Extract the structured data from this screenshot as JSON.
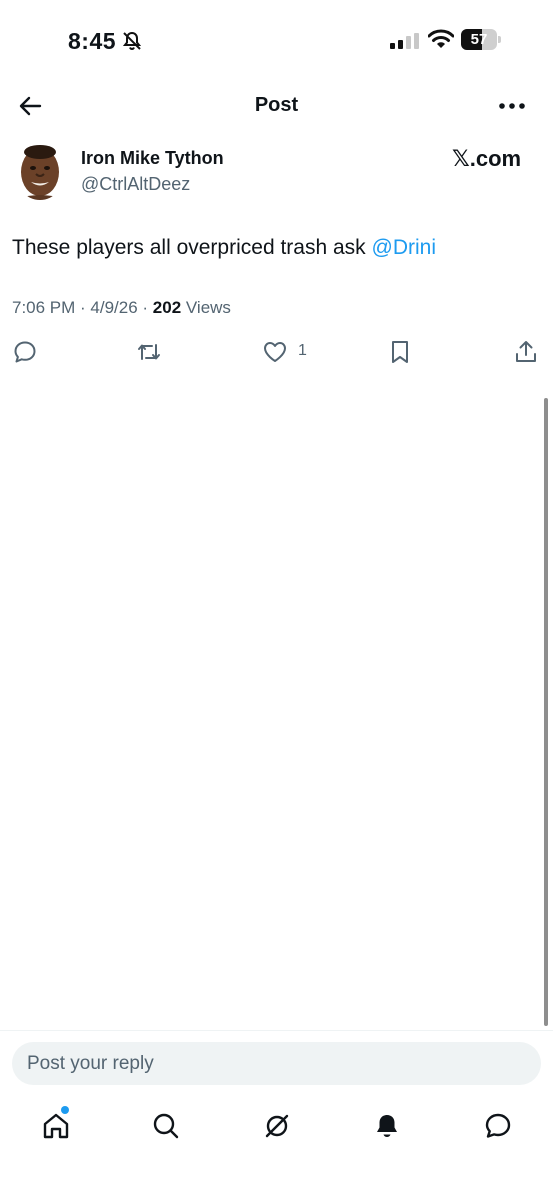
{
  "status_bar": {
    "time": "8:45",
    "battery": "57",
    "battery_level": 0.57,
    "icons": [
      "bell-slash-icon",
      "cellular-signal-icon",
      "wifi-icon",
      "battery-icon"
    ]
  },
  "header": {
    "title": "Post",
    "back_icon": "arrow-left-icon",
    "more_icon": "ellipsis-icon"
  },
  "post": {
    "author_name": "Iron Mike Tython",
    "author_handle": "@CtrlAltDeez",
    "watermark": "𝕏.com",
    "text": "These players all overpriced trash ask ",
    "mention": "@Drini",
    "timestamp": "7:06 PM · 4/9/26 · ",
    "views_count": "202",
    "views_label": " Views",
    "like_count": "1",
    "actions": [
      "reply-icon",
      "repost-icon",
      "like-icon",
      "bookmark-icon",
      "share-icon"
    ]
  },
  "reply": {
    "placeholder": "Post your reply"
  },
  "bottom_nav": {
    "items": [
      "home-icon",
      "search-icon",
      "grok-icon",
      "notifications-icon",
      "messages-icon"
    ]
  },
  "colors": {
    "accent": "#1d9bf0",
    "text": "#0f1419",
    "secondary": "#536471",
    "reply_bg": "#eff3f4"
  }
}
